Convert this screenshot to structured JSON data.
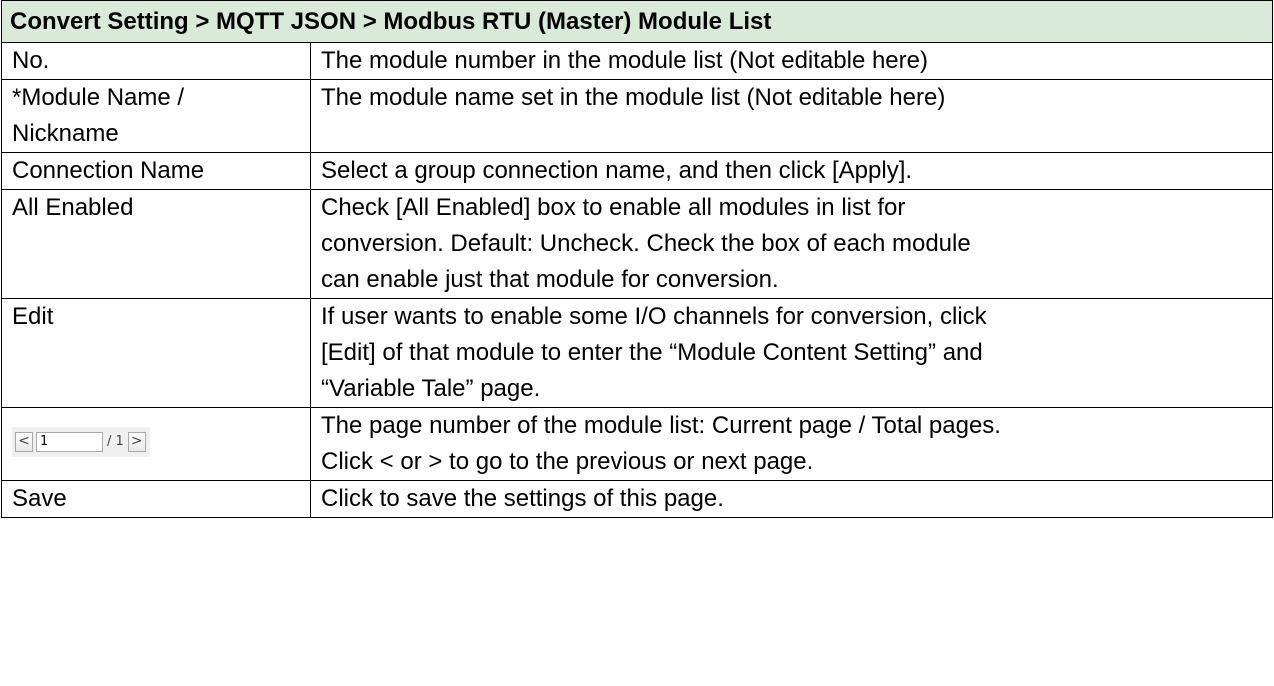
{
  "title": "Convert Setting > MQTT JSON > Modbus RTU (Master) Module List",
  "rows": [
    {
      "field": "No.",
      "desc": "The module number in the module list (Not editable here)"
    },
    {
      "field": "*Module Name /",
      "field2": "Nickname",
      "desc": "The module name set in the module list (Not editable here)"
    },
    {
      "field": "Connection Name",
      "desc": "Select a group connection name, and then click [Apply]."
    },
    {
      "field": "All Enabled",
      "desc": [
        "Check [All Enabled] box to enable all modules in list for",
        "conversion. Default: Uncheck. Check the box of each module",
        "can enable just that module for conversion."
      ]
    },
    {
      "field": "Edit",
      "desc": [
        "If user wants to enable some I/O channels for conversion, click",
        "[Edit] of that module to enter the “Module Content Setting” and",
        "“Variable Tale” page."
      ]
    },
    {
      "field": "",
      "desc": [
        "The page number of the module list: Current page / Total pages.",
        "Click < or > to go to the previous or next page."
      ]
    },
    {
      "field": "Save",
      "desc": "Click to save the settings of this page."
    }
  ],
  "pager": {
    "prev": "<",
    "current_page": "1",
    "total_label": "/ 1",
    "next": ">"
  },
  "colors": {
    "header_bg": "#d9ead8",
    "border": "#000000"
  }
}
